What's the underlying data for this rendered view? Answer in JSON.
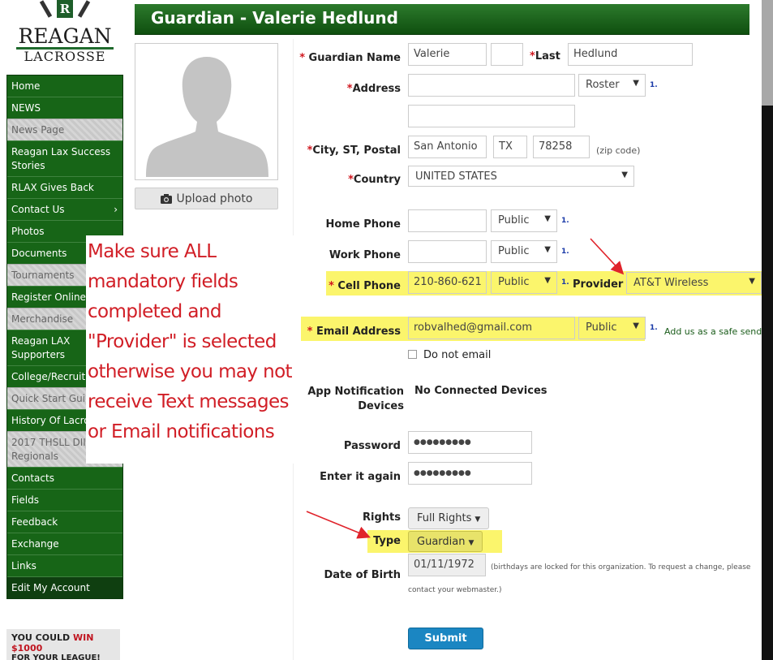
{
  "logo": {
    "line1": "REAGAN",
    "line2": "LACROSSE",
    "badge": "R"
  },
  "nav": [
    {
      "label": "Home",
      "style": "normal"
    },
    {
      "label": "NEWS",
      "style": "normal"
    },
    {
      "label": "News Page",
      "style": "grey"
    },
    {
      "label": "Reagan Lax Success Stories",
      "style": "two"
    },
    {
      "label": "RLAX Gives Back",
      "style": "normal"
    },
    {
      "label": "Contact Us",
      "style": "normal",
      "chevron": "›"
    },
    {
      "label": "Photos",
      "style": "normal"
    },
    {
      "label": "Documents",
      "style": "normal"
    },
    {
      "label": "Tournaments",
      "style": "grey"
    },
    {
      "label": "Register Online",
      "style": "normal"
    },
    {
      "label": "Merchandise",
      "style": "grey"
    },
    {
      "label": "Reagan LAX Supporters",
      "style": "two"
    },
    {
      "label": "College/Recruiting",
      "style": "normal"
    },
    {
      "label": "Quick Start Guide",
      "style": "grey"
    },
    {
      "label": "History Of Lacrosse",
      "style": "normal"
    },
    {
      "label": "2017 THSLL DII Regionals",
      "style": "grey two"
    },
    {
      "label": "Contacts",
      "style": "normal"
    },
    {
      "label": "Fields",
      "style": "normal"
    },
    {
      "label": "Feedback",
      "style": "normal"
    },
    {
      "label": "Exchange",
      "style": "normal"
    },
    {
      "label": "Links",
      "style": "normal"
    },
    {
      "label": "Edit My Account",
      "style": "dark"
    }
  ],
  "promo": {
    "line1_prefix": "YOU COULD ",
    "line1_highlight": "WIN $1000",
    "line2": "FOR YOUR LEAGUE!"
  },
  "header": {
    "title": "Guardian - Valerie Hedlund"
  },
  "photo": {
    "upload_label": "Upload photo"
  },
  "form": {
    "required_mark": "*",
    "guardian_name_label": "Guardian Name",
    "first_name": "Valerie",
    "middle_name": "",
    "last_label": "Last",
    "last_name": "Hedlund",
    "address_label": "Address",
    "address_source": "Roster",
    "address1": "",
    "address2": "",
    "city_label": "City, ST, Postal",
    "city": "San Antonio",
    "state": "TX",
    "postal": "78258",
    "zip_hint": "(zip code)",
    "country_label": "Country",
    "country": "UNITED STATES",
    "home_phone_label": "Home Phone",
    "home_phone": "",
    "home_privacy": "Public",
    "work_phone_label": "Work Phone",
    "work_phone": "",
    "work_privacy": "Public",
    "cell_phone_label": "Cell Phone",
    "cell_phone": "210-860-621",
    "cell_privacy": "Public",
    "provider_label": "Provider",
    "provider": "AT&T Wireless",
    "email_label": "Email Address",
    "email": "robvalhed@gmail.com",
    "email_privacy": "Public",
    "safe_sender": "Add us as a safe sende",
    "do_not_email": "Do not email",
    "app_notif_label_1": "App Notification",
    "app_notif_label_2": "Devices",
    "app_notif_value": "No Connected Devices",
    "password_label": "Password",
    "password": "●●●●●●●●●",
    "confirm_label": "Enter it again",
    "confirm": "●●●●●●●●●",
    "rights_label": "Rights",
    "rights": "Full Rights",
    "type_label": "Type",
    "type": "Guardian",
    "dob_label": "Date of Birth",
    "dob": "01/11/1972",
    "dob_hint_1": "(birthdays are locked for this organization. To request a change, please",
    "dob_hint_2": "contact your webmaster.)",
    "footnote": "1.",
    "submit": "Submit"
  },
  "annotation": {
    "text": "Make sure ALL mandatory fields completed and \"Provider\" is selected otherwise you may not receive Text messages or Email notifications"
  },
  "colors": {
    "nav_green": "#176517",
    "header_green": "#1a631a",
    "highlight": "#fbf56c",
    "annotation": "#d11e26",
    "submit": "#1b86c2"
  }
}
